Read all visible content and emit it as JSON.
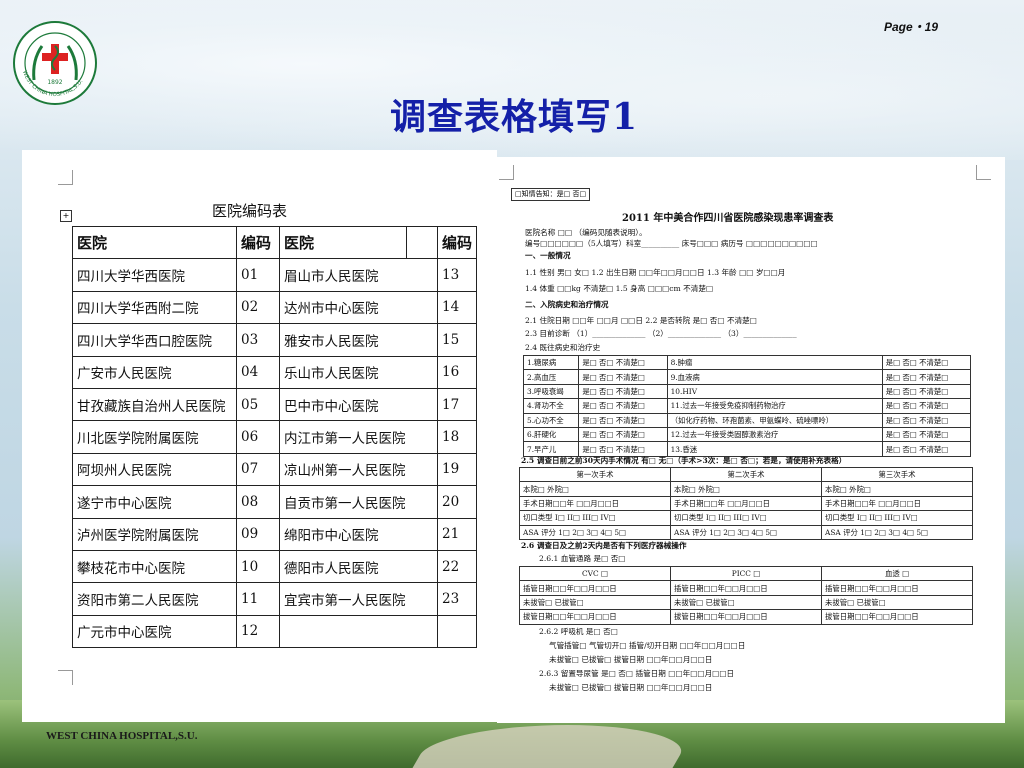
{
  "page": "Page・19",
  "title": "调查表格填写1",
  "logo": {
    "year": "1892",
    "ring_text": "WEST CHINA HOSPITAL,S.U."
  },
  "footer_brand": "WEST CHINA HOSPITAL,S.U.",
  "codes": {
    "title": "医院编码表",
    "headers": [
      "医院",
      "编码",
      "医院",
      "",
      "编码"
    ],
    "rows": [
      [
        "四川大学华西医院",
        "01",
        "眉山市人民医院",
        "13"
      ],
      [
        "四川大学华西附二院",
        "02",
        "达州市中心医院",
        "14"
      ],
      [
        "四川大学华西口腔医院",
        "03",
        "雅安市人民医院",
        "15"
      ],
      [
        "广安市人民医院",
        "04",
        "乐山市人民医院",
        "16"
      ],
      [
        "甘孜藏族自治州人民医院",
        "05",
        "巴中市中心医院",
        "17"
      ],
      [
        "川北医学院附属医院",
        "06",
        "内江市第一人民医院",
        "18"
      ],
      [
        "阿坝州人民医院",
        "07",
        "凉山州第一人民医院",
        "19"
      ],
      [
        "遂宁市中心医院",
        "08",
        "自贡市第一人民医院",
        "20"
      ],
      [
        "泸州医学院附属医院",
        "09",
        "绵阳市中心医院",
        "21"
      ],
      [
        "攀枝花市中心医院",
        "10",
        "德阳市人民医院",
        "22"
      ],
      [
        "资阳市第二人民医院",
        "11",
        "宜宾市第一人民医院",
        "23"
      ],
      [
        "广元市中心医院",
        "12",
        "",
        ""
      ]
    ]
  },
  "survey": {
    "consent": "□知情告知：是□ 否□",
    "title": "2011 年中美合作四川省医院感染现患率调查表",
    "l1": "医院名称 □□ （编码见随表说明）。",
    "l2": "编号□□□□□□（5人填写）科室__________ 床号□□□    病历号 □□□□□□□□□□",
    "s1": "一、一般情况",
    "l3": "1.1 性别   男□ 女□         1.2  出生日期 □□年□□月□□日     1.3 年龄 □□ 岁□□月",
    "l4": "1.4 体重 □□kg 不清楚□    1.5 身高 □□□cm 不清楚□",
    "s2": "二、入院病史和治疗情况",
    "l5": "2.1 住院日期  □□年 □□月 □□日         2.2 是否转院  是□ 否□  不清楚□",
    "l6": "2.3 目前诊断  （1）______________ （2）______________ （3）______________",
    "l7": "2.4  既往病史和治疗史",
    "history": [
      [
        "1.糖尿病",
        "是□ 否□ 不清楚□",
        "8.肿瘤",
        "是□ 否□ 不清楚□"
      ],
      [
        "2.高血压",
        "是□ 否□ 不清楚□",
        "9.血液病",
        "是□ 否□ 不清楚□"
      ],
      [
        "3.呼吸衰竭",
        "是□ 否□ 不清楚□",
        "10.HIV",
        "是□ 否□ 不清楚□"
      ],
      [
        "4.肾功不全",
        "是□ 否□ 不清楚□",
        "11.过去一年接受免疫抑制药物治疗",
        "是□ 否□ 不清楚□"
      ],
      [
        "5.心功不全",
        "是□ 否□ 不清楚□",
        "（如化疗药物、环孢菌素、甲氨蝶呤、硫唑嘌呤）",
        "是□ 否□ 不清楚□"
      ],
      [
        "6.肝硬化",
        "是□ 否□ 不清楚□",
        "12.过去一年接受类固醇激素治疗",
        "是□ 否□ 不清楚□"
      ],
      [
        "7.早产儿",
        "是□ 否□ 不清楚□",
        "13.昏迷",
        "是□ 否□ 不清楚□"
      ]
    ],
    "l8": "2.5  调查日前之前30天内手术情况 有□ 无□（手术>3次：是□ 否□；若是，请使用补充表格）",
    "surgery_headers": [
      "第一次手术",
      "第二次手术",
      "第三次手术"
    ],
    "surgery_rows": [
      "本院□   外院□",
      "手术日期□□年 □□月□□日",
      "切口类型   I□ II□ III□ IV□",
      "ASA 评分   1□ 2□ 3□ 4□ 5□"
    ],
    "l9": "2.6  调查日及之前2天内是否有下列医疗器械操作",
    "l10": "2.6.1 血管通路   是□ 否□",
    "device_headers": [
      "CVC  □",
      "PICC  □",
      "血透  □"
    ],
    "device_rows": [
      "插管日期□□年□□月□□日",
      "未拔管□       已拔管□",
      "拔管日期□□年□□月□□日"
    ],
    "l11": "2.6.2  呼吸机          是□ 否□",
    "l12": "气管插管□           气管切开□                插管/切开日期   □□年□□月□□日",
    "l13": "未拔管□             已拔管□                  拔管日期        □□年□□月□□日",
    "l14": "2.6.3 留置导尿管      是□ 否□                  插管日期        □□年□□月□□日",
    "l15": "未拔管□             已拔管□                  拔管日期        □□年□□月□□日"
  }
}
